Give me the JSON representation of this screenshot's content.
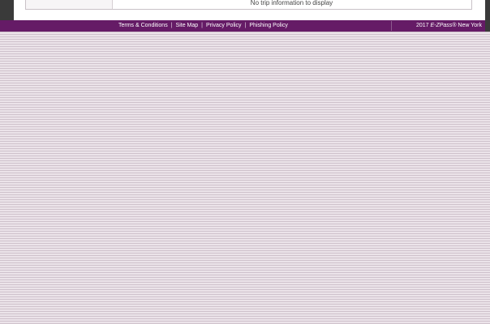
{
  "trip_table": {
    "empty_message": "No trip information to display"
  },
  "footer": {
    "links": {
      "terms": "Terms & Conditions",
      "sitemap": "Site Map",
      "privacy": "Privacy Policy",
      "phishing": "Phishing Policy"
    },
    "separator": "|",
    "copyright": {
      "year": "2017",
      "brand": "E-ZPass®",
      "region": "New York"
    }
  },
  "colors": {
    "footer_bg": "#651b66",
    "page_bg": "#e4dae2",
    "frame": "#3a3a3a"
  }
}
